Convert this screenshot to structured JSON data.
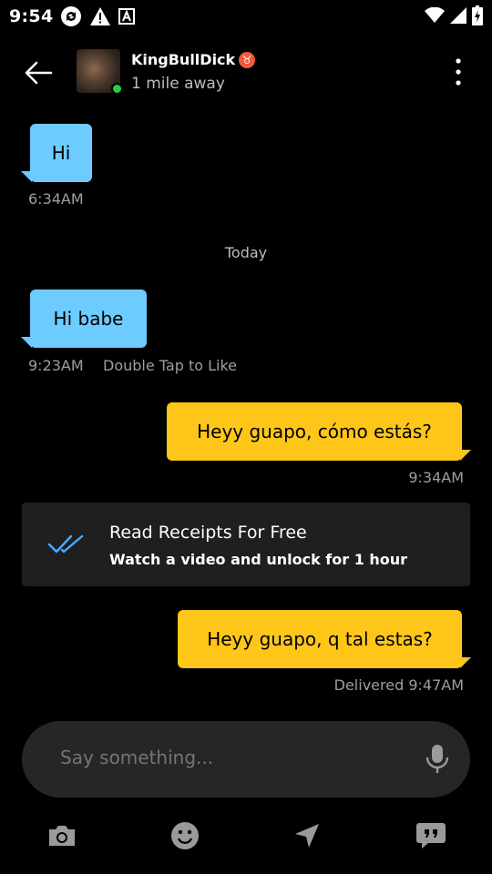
{
  "status_bar": {
    "time": "9:54",
    "icons_left": [
      "sync-icon",
      "warning-icon",
      "font-a-icon"
    ],
    "icons_right": [
      "wifi-icon",
      "signal-icon",
      "battery-icon"
    ]
  },
  "header": {
    "name": "KingBullDick",
    "zodiac_symbol": "♉",
    "distance": "1 mile away",
    "online": true
  },
  "messages": [
    {
      "direction": "in",
      "text": "Hi",
      "time": "6:34AM",
      "extra": ""
    },
    {
      "direction": "in",
      "text": "Hi babe",
      "time": "9:23AM",
      "extra": "Double Tap to Like"
    },
    {
      "direction": "out",
      "text": "Heyy guapo, cómo estás?",
      "time": "9:34AM"
    },
    {
      "direction": "out",
      "text": "Heyy guapo, q tal estas?",
      "time": "Delivered 9:47AM"
    }
  ],
  "day_divider": "Today",
  "receipt_card": {
    "title": "Read Receipts For Free",
    "subtitle": "Watch a video and unlock for 1 hour"
  },
  "composer": {
    "placeholder": "Say something..."
  },
  "toolbar": [
    "camera-icon",
    "emoji-icon",
    "location-icon",
    "phrases-icon"
  ],
  "colors": {
    "incoming_bubble": "#6ecbff",
    "outgoing_bubble": "#ffc61a",
    "background": "#000000",
    "card": "#1f1f1f",
    "online": "#22d04a",
    "accent_check": "#4aa8ff"
  }
}
